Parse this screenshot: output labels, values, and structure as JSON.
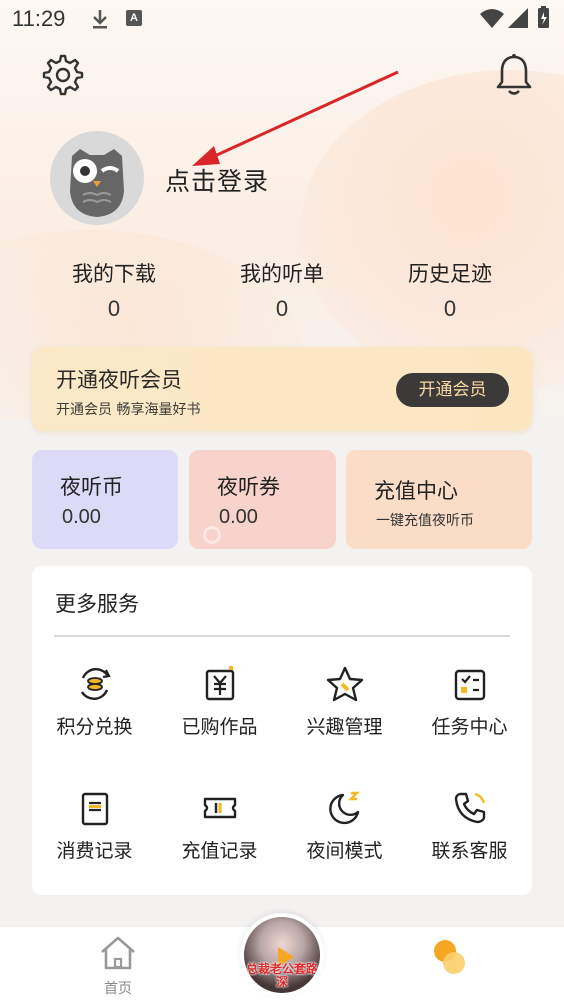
{
  "status_bar": {
    "time": "11:29",
    "a_badge": "A"
  },
  "header": {
    "settings_icon": "gear-icon",
    "notify_icon": "bell-icon"
  },
  "profile": {
    "login_text": "点击登录",
    "avatar_icon": "owl-avatar-icon"
  },
  "stats": [
    {
      "label": "我的下载",
      "value": "0"
    },
    {
      "label": "我的听单",
      "value": "0"
    },
    {
      "label": "历史足迹",
      "value": "0"
    }
  ],
  "vip": {
    "title": "开通夜听会员",
    "subtitle": "开通会员 畅享海量好书",
    "button": "开通会员"
  },
  "wallet": [
    {
      "title": "夜听币",
      "value": "0.00",
      "color": "#dcdaf7"
    },
    {
      "title": "夜听券",
      "value": "0.00",
      "color": "#f8d3cb"
    },
    {
      "title": "充值中心",
      "value": "一键充值夜听币",
      "color": "#fbdcc6"
    }
  ],
  "services": {
    "title": "更多服务",
    "items": [
      {
        "label": "积分兑换",
        "icon": "points-exchange-icon"
      },
      {
        "label": "已购作品",
        "icon": "purchased-yen-icon"
      },
      {
        "label": "兴趣管理",
        "icon": "star-icon"
      },
      {
        "label": "任务中心",
        "icon": "task-checklist-icon"
      },
      {
        "label": "消费记录",
        "icon": "receipt-icon"
      },
      {
        "label": "充值记录",
        "icon": "ticket-icon"
      },
      {
        "label": "夜间模式",
        "icon": "moon-icon"
      },
      {
        "label": "联系客服",
        "icon": "phone-icon"
      }
    ]
  },
  "bottom_nav": {
    "home_label": "首页",
    "center_text": "总裁老公套路深",
    "accent": "#f5a623"
  }
}
